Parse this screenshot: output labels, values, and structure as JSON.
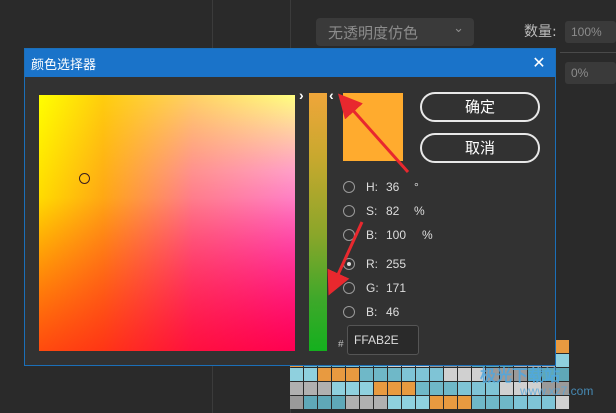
{
  "background": {
    "dropdown_value": "无透明度仿色",
    "quantity_label": "数量:",
    "quantity_value": "100%",
    "second_value": "0%"
  },
  "dialog": {
    "title": "颜色选择器",
    "close_icon": "close-icon",
    "ok_label": "确定",
    "cancel_label": "取消",
    "selected_color": "#FFAB2E",
    "fields": [
      {
        "label": "H:",
        "value": "36",
        "unit": "°",
        "checked": false
      },
      {
        "label": "S:",
        "value": "82",
        "unit": "%",
        "checked": false
      },
      {
        "label": "B:",
        "value": "100",
        "unit": "%",
        "checked": false
      },
      {
        "label": "R:",
        "value": "255",
        "unit": "",
        "checked": true
      },
      {
        "label": "G:",
        "value": "171",
        "unit": "",
        "checked": false
      },
      {
        "label": "B:",
        "value": "46",
        "unit": "",
        "checked": false
      }
    ],
    "hash_label": "#",
    "hex_value": "FFAB2E"
  },
  "watermark": {
    "line1": "极光下载站",
    "line2": "www.xz7.com"
  },
  "colors": {
    "titlebar": "#1a73c9",
    "annotation_arrow": "#e8282e"
  }
}
